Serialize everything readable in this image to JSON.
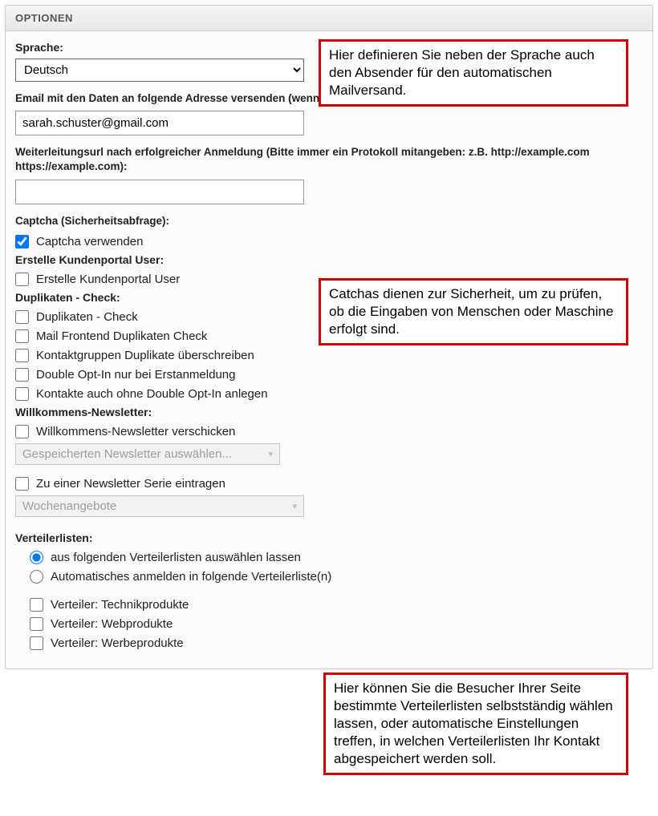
{
  "panel": {
    "title": "OPTIONEN"
  },
  "language": {
    "label": "Sprache:",
    "value": "Deutsch",
    "options": [
      "Deutsch"
    ]
  },
  "email_forward": {
    "label": "Email mit den Daten an folgende Adresse versenden (wenn dieses Feld leer ist, wird keine Mail versendet):",
    "value": "sarah.schuster@gmail.com"
  },
  "redirect_url": {
    "label": "Weiterleitungsurl nach erfolgreicher Anmeldung (Bitte immer ein Protokoll mitangeben: z.B. http://example.com https://example.com):",
    "value": ""
  },
  "captcha": {
    "heading": "Captcha (Sicherheitsabfrage):",
    "use_label": "Captcha verwenden",
    "use_checked": true
  },
  "portal_user": {
    "heading": "Erstelle Kundenportal User:",
    "create_label": "Erstelle Kundenportal User",
    "create_checked": false
  },
  "duplicate_check": {
    "heading": "Duplikaten - Check:",
    "items": [
      {
        "label": "Duplikaten - Check",
        "checked": false
      },
      {
        "label": "Mail Frontend Duplikaten Check",
        "checked": false
      },
      {
        "label": "Kontaktgruppen Duplikate überschreiben",
        "checked": false
      },
      {
        "label": "Double Opt-In nur bei Erstanmeldung",
        "checked": false
      },
      {
        "label": "Kontakte auch ohne Double Opt-In anlegen",
        "checked": false
      }
    ]
  },
  "welcome_newsletter": {
    "heading": "Willkommens-Newsletter:",
    "send_label": "Willkommens-Newsletter verschicken",
    "send_checked": false,
    "saved_select": "Gespeicherten Newsletter auswählen...",
    "series_label": "Zu einer Newsletter Serie eintragen",
    "series_checked": false,
    "series_select": "Wochenangebote"
  },
  "dist_lists": {
    "heading": "Verteilerlisten:",
    "mode": "choose",
    "options": {
      "choose": "aus folgenden Verteilerlisten auswählen lassen",
      "auto": "Automatisches anmelden in folgende Verteilerliste(n)"
    },
    "lists": [
      {
        "label": "Verteiler: Technikprodukte",
        "checked": false
      },
      {
        "label": "Verteiler: Webprodukte",
        "checked": false
      },
      {
        "label": "Verteiler: Werbeprodukte",
        "checked": false
      }
    ]
  },
  "callouts": {
    "c1": "Hier definieren Sie neben der Sprache auch den Absender für den automatischen Mailversand.",
    "c2": "Catchas dienen zur Sicherheit, um zu prüfen, ob die Eingaben von Menschen oder Maschine erfolgt sind.",
    "c3": "Hier können Sie die Besucher Ihrer Seite bestimmte Verteilerlisten selbstständig wählen lassen, oder automatische Einstellungen treffen, in welchen Verteilerlisten Ihr Kontakt abgespeichert werden soll."
  }
}
